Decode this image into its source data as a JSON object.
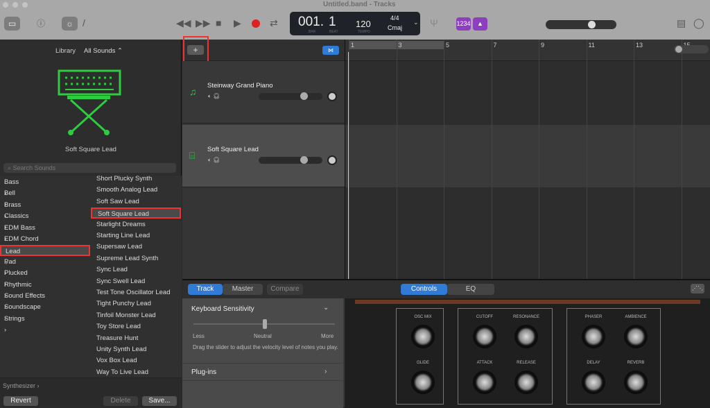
{
  "window": {
    "title": "Untitled.band - Tracks"
  },
  "lcd": {
    "bar": "001.",
    "beat": "1",
    "bar_label": "BAR",
    "beat_label": "BEAT",
    "tempo": "120",
    "tempo_label": "TEMPO",
    "signature": "4/4",
    "key": "Cmaj"
  },
  "toolbar": {
    "count_in": "1234",
    "master_volume": 0.6
  },
  "library": {
    "title": "Library",
    "filter": "All Sounds ⌃",
    "instrument_name": "Soft Square Lead",
    "search_placeholder": "Search Sounds",
    "categories": [
      "Bass",
      "Bell",
      "Brass",
      "Classics",
      "EDM Bass",
      "EDM Chord",
      "Lead",
      "Pad",
      "Plucked",
      "Rhythmic",
      "Sound Effects",
      "Soundscape",
      "Strings"
    ],
    "selected_category": "Lead",
    "sounds": [
      "Short Plucky Synth",
      "Smooth Analog Lead",
      "Soft Saw Lead",
      "Soft Square Lead",
      "Starlight Dreams",
      "Starting Line Lead",
      "Supersaw Lead",
      "Supreme Lead Synth",
      "Sync Lead",
      "Sync Swell Lead",
      "Test Tone Oscillator Lead",
      "Tight Punchy Lead",
      "Tinfoil Monster Lead",
      "Toy Store Lead",
      "Treasure Hunt",
      "Unity Synth Lead",
      "Vox Box Lead",
      "Way To Live Lead"
    ],
    "selected_sound": "Soft Square Lead",
    "footer_path": "Synthesizer ›",
    "revert": "Revert",
    "delete": "Delete",
    "save": "Save..."
  },
  "tracks": {
    "add": "+",
    "items": [
      {
        "name": "Steinway Grand Piano"
      },
      {
        "name": "Soft Square Lead"
      }
    ]
  },
  "ruler": {
    "bars": [
      "1",
      "3",
      "5",
      "7",
      "9",
      "11",
      "13",
      "15"
    ]
  },
  "smart_controls": {
    "tabs": [
      "Track",
      "Master",
      "Compare"
    ],
    "right_tabs": [
      "Controls",
      "EQ"
    ],
    "keyboard_sensitivity": "Keyboard Sensitivity",
    "less": "Less",
    "neutral": "Neutral",
    "more": "More",
    "help": "Drag the slider to adjust the velocity level of notes you play.",
    "plugins": "Plug-ins",
    "knobs": [
      "OSC MIX",
      "GLIDE",
      "CUTOFF",
      "RESONANCE",
      "ATTACK",
      "RELEASE",
      "PHASER",
      "AMBIENCE",
      "DELAY",
      "REVERB"
    ]
  },
  "colors": {
    "accent": "#2f7bd6",
    "highlight": "#e33a2c",
    "instrument": "#2ecc40",
    "record": "#e02020"
  }
}
